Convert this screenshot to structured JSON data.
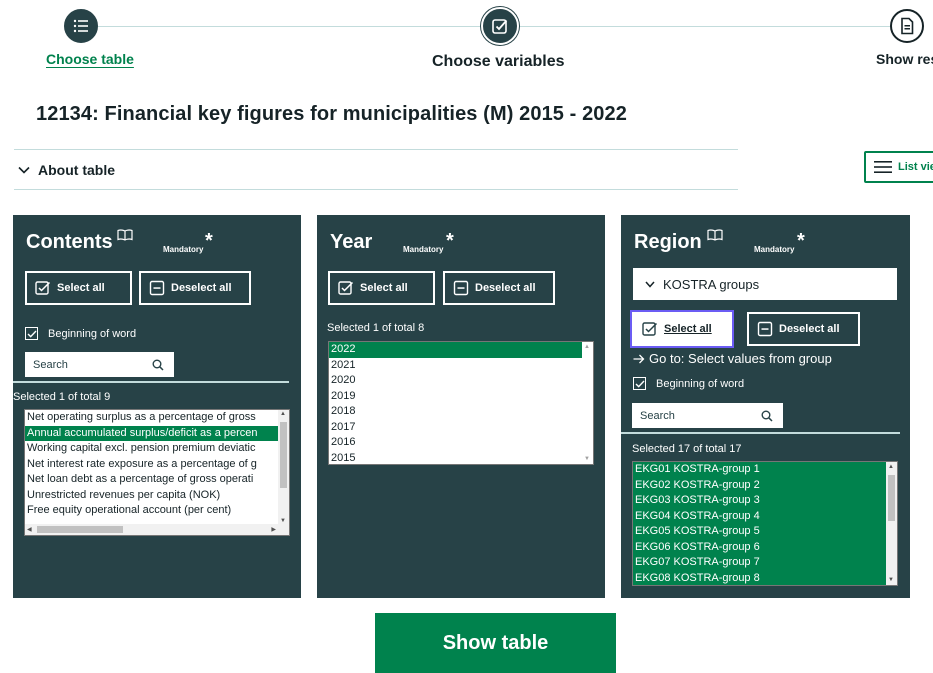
{
  "stepper": {
    "steps": [
      {
        "label": "Choose table",
        "icon": "list-icon",
        "state": "done"
      },
      {
        "label": "Choose variables",
        "icon": "checkbox-edit-icon",
        "state": "current"
      },
      {
        "label": "Show resu",
        "icon": "document-icon",
        "state": "upcoming"
      }
    ]
  },
  "table_title": "12134: Financial key figures for municipalities (M) 2015 - 2022",
  "about_table": {
    "label": "About table",
    "icon": "chevron-down-icon"
  },
  "list_view": {
    "label": "List vie",
    "icon": "list-lines-icon"
  },
  "common": {
    "mandatory": "Mandatory",
    "star": "*",
    "select_all": "Select all",
    "deselect_all": "Deselect all",
    "beginning_of_word": "Beginning of word",
    "search_placeholder": "Search"
  },
  "contents": {
    "title": "Contents",
    "selected_count": "Selected 1 of total 9",
    "items": [
      {
        "label": "Net operating surplus as a percentage of gross",
        "selected": false
      },
      {
        "label": "Annual accumulated surplus/deficit as a percen",
        "selected": true
      },
      {
        "label": "Working capital excl. pension premium deviatic",
        "selected": false
      },
      {
        "label": "Net interest rate exposure as a percentage of g",
        "selected": false
      },
      {
        "label": "Net loan debt as a percentage of gross operati",
        "selected": false
      },
      {
        "label": "Unrestricted revenues per capita (NOK)",
        "selected": false
      },
      {
        "label": "Free equity operational account (per cent)",
        "selected": false
      }
    ]
  },
  "year": {
    "title": "Year",
    "selected_count": "Selected 1 of total 8",
    "items": [
      {
        "label": "2022",
        "selected": true
      },
      {
        "label": "2021",
        "selected": false
      },
      {
        "label": "2020",
        "selected": false
      },
      {
        "label": "2019",
        "selected": false
      },
      {
        "label": "2018",
        "selected": false
      },
      {
        "label": "2017",
        "selected": false
      },
      {
        "label": "2016",
        "selected": false
      },
      {
        "label": "2015",
        "selected": false
      }
    ]
  },
  "region": {
    "title": "Region",
    "dropdown": "KOSTRA groups",
    "goto": "Go to: Select values from group",
    "selected_count": "Selected 17 of total 17",
    "items": [
      {
        "label": "EKG01 KOSTRA-group 1",
        "selected": true
      },
      {
        "label": "EKG02 KOSTRA-group 2",
        "selected": true
      },
      {
        "label": "EKG03 KOSTRA-group 3",
        "selected": true
      },
      {
        "label": "EKG04 KOSTRA-group 4",
        "selected": true
      },
      {
        "label": "EKG05 KOSTRA-group 5",
        "selected": true
      },
      {
        "label": "EKG06 KOSTRA-group 6",
        "selected": true
      },
      {
        "label": "EKG07 KOSTRA-group 7",
        "selected": true
      },
      {
        "label": "EKG08 KOSTRA-group 8",
        "selected": true
      }
    ]
  },
  "show_table": "Show table",
  "colors": {
    "accent_green": "#00824d",
    "panel_dark": "#274247",
    "focus_ring": "#6b5cf4"
  }
}
